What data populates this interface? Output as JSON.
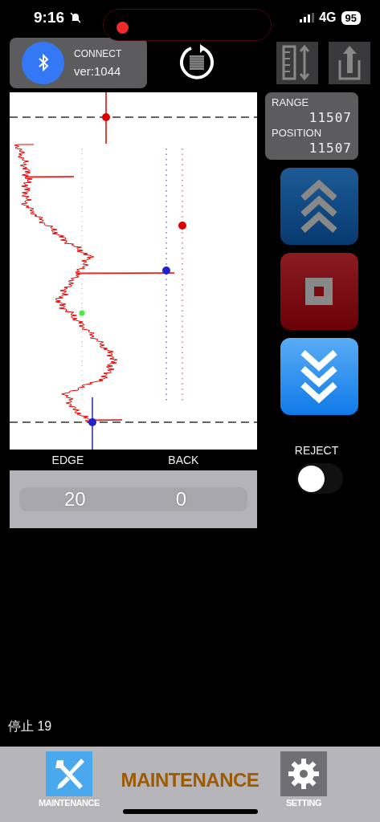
{
  "status_bar": {
    "time": "9:16",
    "network": "4G",
    "battery": "95"
  },
  "connection": {
    "label": "CONNECT",
    "version": "ver:1044"
  },
  "readout": [
    {
      "label": "RANGE",
      "value": "11507"
    },
    {
      "label": "POSITION",
      "value": "11507"
    }
  ],
  "picker": [
    {
      "label": "EDGE",
      "value": "20"
    },
    {
      "label": "BACK",
      "value": "0"
    }
  ],
  "reject": {
    "label": "REJECT",
    "on": false
  },
  "status_text": "停止 19",
  "title": "MAINTENANCE",
  "tabs": [
    {
      "kind": "maintenance",
      "label": "MAINTENANCE",
      "selected": true
    },
    {
      "kind": "setting",
      "label": "SETTING",
      "selected": false
    }
  ]
}
